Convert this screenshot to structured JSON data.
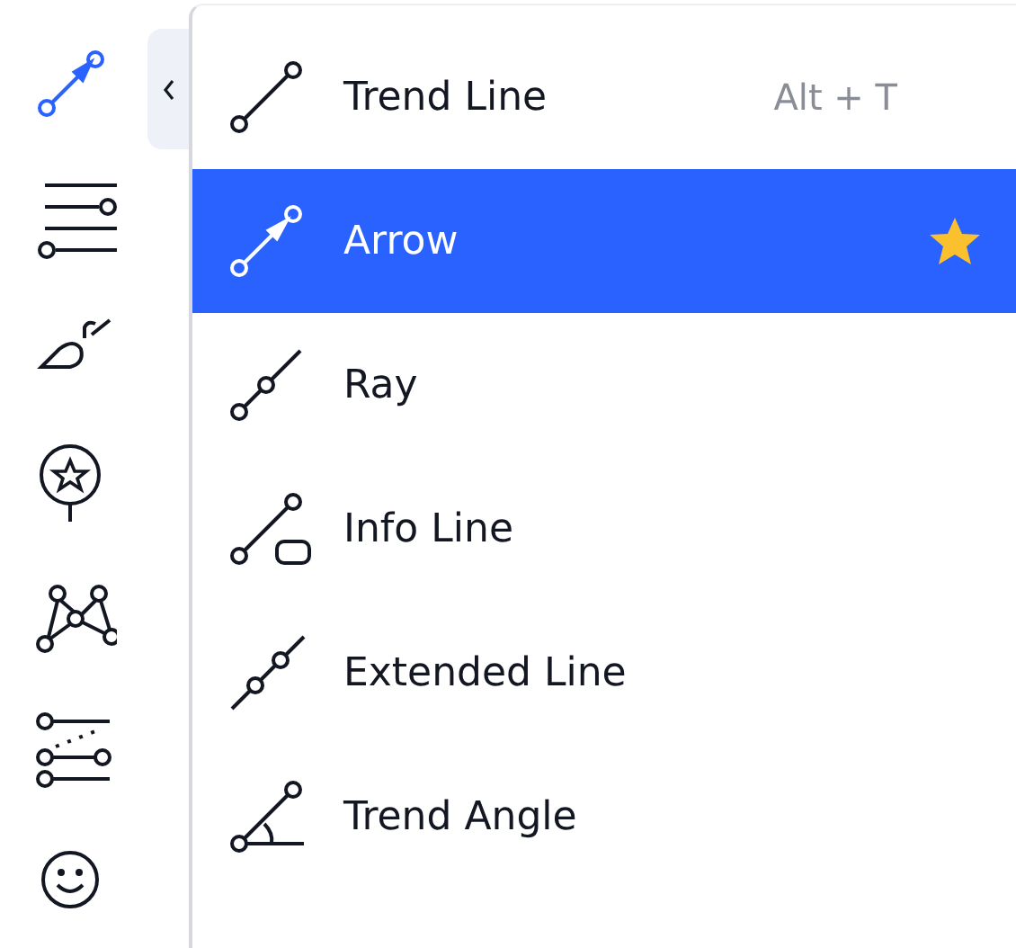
{
  "toolbar": {
    "tools": [
      {
        "selected": true
      },
      {
        "selected": false
      },
      {
        "selected": false
      },
      {
        "selected": false
      },
      {
        "selected": false
      },
      {
        "selected": false
      },
      {
        "selected": false
      }
    ],
    "collapse_button": {
      "expanded": true
    }
  },
  "menu": {
    "items": [
      {
        "label": "Trend Line",
        "shortcut": "Alt + T",
        "selected": false,
        "favorite": false
      },
      {
        "label": "Arrow",
        "selected": true,
        "favorite": true
      },
      {
        "label": "Ray",
        "selected": false,
        "favorite": false
      },
      {
        "label": "Info Line",
        "selected": false,
        "favorite": false
      },
      {
        "label": "Extended Line",
        "selected": false,
        "favorite": false
      },
      {
        "label": "Trend Angle",
        "selected": false,
        "favorite": false
      }
    ]
  }
}
